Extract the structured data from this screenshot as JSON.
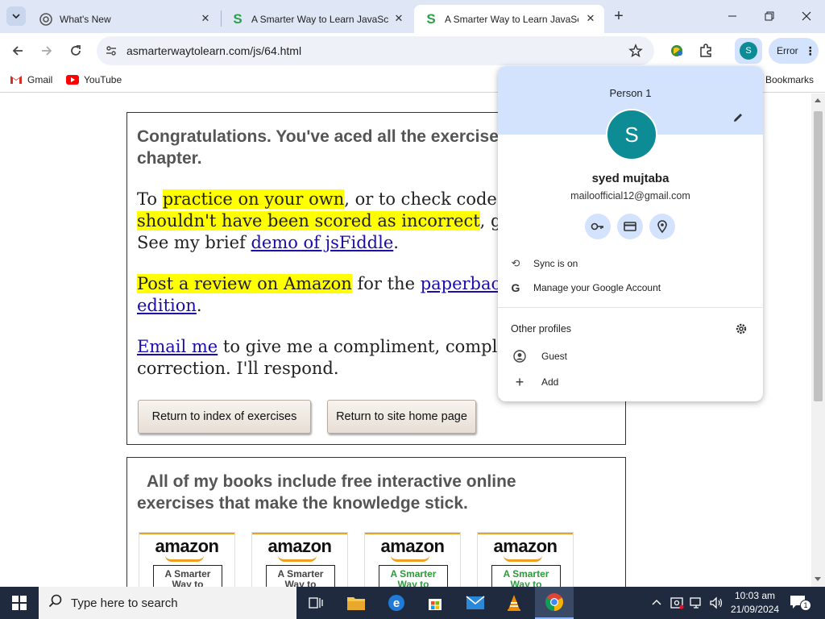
{
  "tabs": [
    {
      "title": "What's New",
      "icon": "chrome-icon",
      "active": false
    },
    {
      "title": "A Smarter Way to Learn JavaScript",
      "icon": "site-s-icon",
      "active": false
    },
    {
      "title": "A Smarter Way to Learn JavaScript",
      "icon": "site-s-icon",
      "active": true
    }
  ],
  "toolbar": {
    "url": "asmarterwaytolearn.com/js/64.html",
    "error_label": "Error",
    "profile_initial": "S"
  },
  "bookmarks": {
    "items": [
      "Gmail",
      "YouTube"
    ],
    "all_bookmarks": "Bookmarks"
  },
  "page": {
    "congrats": "Congratulations. You've aced all the exercises for this chapter.",
    "para1": {
      "t1": "To ",
      "hl1": "practice on your own",
      "t2": ", or to check code you think ",
      "hl2": "shouldn't have been scored as incorrect",
      "t3": ", go to jsFiddle. See my brief ",
      "link": "demo of jsFiddle",
      "t4": "."
    },
    "para2": {
      "hl": "Post a review on Amazon",
      "t1": " for the ",
      "link1": "paperback",
      "t2": " or ",
      "link2": "Kindle edition",
      "t3": "."
    },
    "para3": {
      "link": "Email me",
      "t1": " to give me a compliment, complaint, or correction. I'll respond."
    },
    "btn_index": "Return to index of exercises",
    "btn_home": "Return to site home page",
    "books_heading": "All of my books include free interactive online exercises that make the knowledge stick.",
    "amazon_word": "amazon",
    "book_covers": [
      "A Smarter Way to",
      "A Smarter Way to",
      "A Smarter Way to",
      "A Smarter Way to"
    ]
  },
  "profile": {
    "heading": "Person 1",
    "avatar_initial": "S",
    "name": "syed mujtaba",
    "email": "mailoofficial12@gmail.com",
    "sync": "Sync is on",
    "manage": "Manage your Google Account",
    "other_profiles": "Other profiles",
    "guest": "Guest",
    "add": "Add"
  },
  "taskbar": {
    "search_placeholder": "Type here to search",
    "time": "10:03 am",
    "date": "21/09/2024",
    "notification_count": "1"
  },
  "colors": {
    "tabstrip": "#dfe7f6",
    "profile_accent": "#d3e3fd",
    "avatar": "#0d8c96",
    "highlight": "#ffff00",
    "taskbar": "#1f2a3e"
  }
}
